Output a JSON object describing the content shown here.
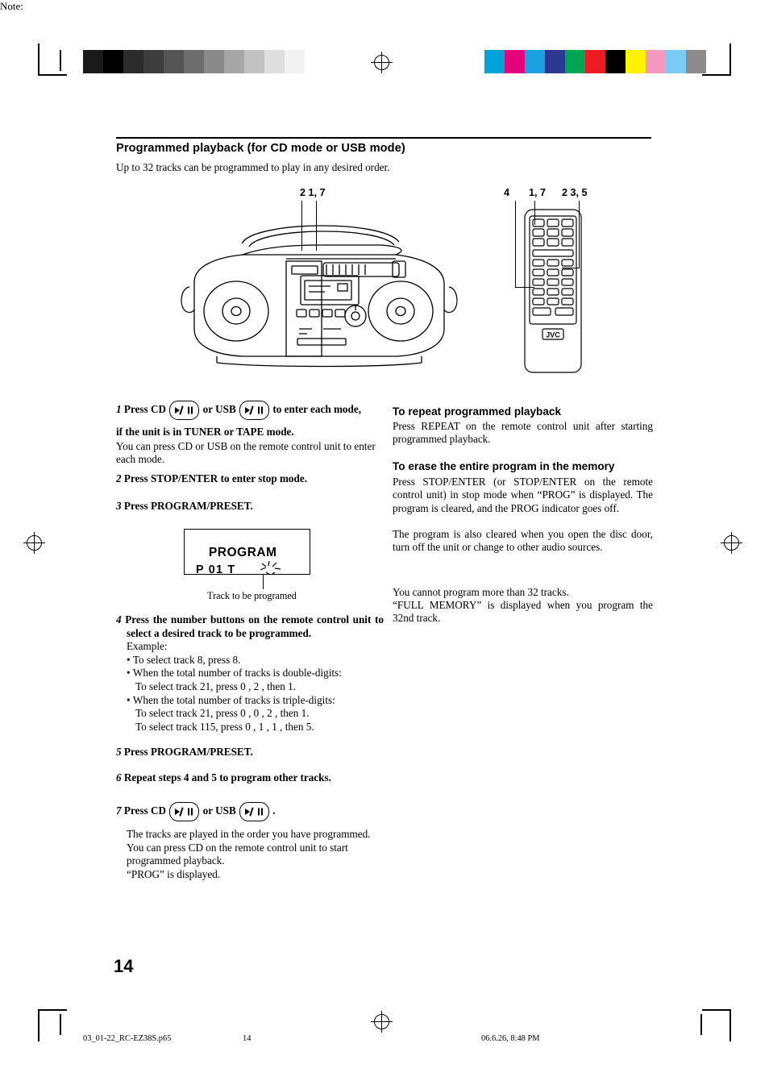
{
  "document": {
    "page_number": "14",
    "footer_left": "03_01-22_RC-EZ38S.p65",
    "footer_center": "14",
    "footer_right": "06.6.26, 8:48 PM"
  },
  "header": {
    "title": "Programmed playback (for CD mode or USB mode)",
    "subtitle": "Up to 32 tracks can be programmed to play in any desired order."
  },
  "callouts": {
    "unit": [
      "2 1, 7"
    ],
    "remote": [
      "4",
      "1, 7",
      "2 3, 5"
    ],
    "remote_brand": "JVC"
  },
  "steps": [
    {
      "num": "1",
      "bold_lead": "Press CD",
      "mid": "or USB",
      "bold_tail": "to enter each mode,",
      "bold_line2": "if the unit is in TUNER or TAPE mode.",
      "body": "You can press CD or USB on the remote control unit to enter each mode.",
      "btn1": "▶/II",
      "btn2": "▶/II"
    },
    {
      "num": "2",
      "bold_lead": "Press STOP/ENTER to enter stop mode."
    },
    {
      "num": "3",
      "bold_lead": "Press PROGRAM/PRESET."
    },
    {
      "num": "4",
      "bold_lead": "Press the number buttons on the remote control unit to select a desired track to be programmed.",
      "body": "Example:",
      "bullets": [
        "To select track 8, press 8.",
        "When the total number of tracks is double-digits:\nTo select track 21, press 0 , 2 , then 1.",
        "When the total number of tracks is triple-digits:\nTo select track 21, press 0 , 0 , 2 , then 1.\nTo select track 115, press 0 , 1 , 1 , then 5."
      ]
    },
    {
      "num": "5",
      "bold_lead": "Press PROGRAM/PRESET."
    },
    {
      "num": "6",
      "bold_lead": "Repeat steps 4 and 5 to program other tracks."
    },
    {
      "num": "7",
      "bold_lead": "Press CD",
      "mid": "or USB",
      "bold_tail": ".",
      "body_lines": [
        "The tracks are played in the order you have programmed.",
        "You can press CD on the remote control unit to start programmed playback.",
        "“PROG” is displayed."
      ],
      "btn1": "▶/II",
      "btn2": "▶/II"
    }
  ],
  "lcd": {
    "program_label": "PROGRAM",
    "line2": "P 01      T",
    "caption": "Track to be programed"
  },
  "right_column": {
    "repeat_heading": "To repeat programmed playback",
    "repeat_body": "Press REPEAT on the remote control unit after starting programmed playback.",
    "erase_heading": "To erase the entire program in the memory",
    "erase_body1": "Press STOP/ENTER (or STOP/ENTER on the remote control unit) in stop mode when “PROG” is displayed. The program is cleared, and the PROG indicator goes off.",
    "erase_body2": "The program is also cleared when you open the disc door, turn off the unit or change to other audio sources.",
    "note_heading": "Note:",
    "note_body1": "You cannot program more than 32 tracks.",
    "note_body2": "“FULL MEMORY” is displayed when you program the 32nd track."
  },
  "print_marks": {
    "gray_swatches": [
      "#1a1a1a",
      "#000000",
      "#2b2b2b",
      "#3d3d3d",
      "#555555",
      "#6e6e6e",
      "#8a8a8a",
      "#a6a6a6",
      "#c2c2c2",
      "#dedede",
      "#f2f2f2"
    ],
    "color_swatches": [
      "#00a3d9",
      "#e5007e",
      "#1ba1e2",
      "#2b3990",
      "#00a651",
      "#ed1c24",
      "#000000",
      "#fff200",
      "#f49ac1",
      "#7accf4",
      "#8c8c8c"
    ]
  }
}
